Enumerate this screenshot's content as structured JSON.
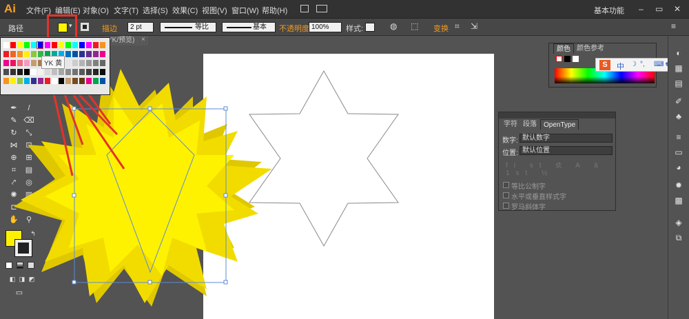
{
  "app": {
    "logo": "Ai",
    "workspace": "基本功能"
  },
  "menus": [
    "文件(F)",
    "编辑(E)",
    "对象(O)",
    "文字(T)",
    "选择(S)",
    "效果(C)",
    "视图(V)",
    "窗口(W)",
    "帮助(H)"
  ],
  "control_bar": {
    "selection_label": "路径",
    "stroke_label": "描边",
    "stroke_weight": "2 pt",
    "profile_label": "等比",
    "brush_label": "基本",
    "opacity_label": "不透明度",
    "opacity_value": "100%",
    "style_label": "样式:",
    "transform_label": "变换",
    "fill_color": "#fff200"
  },
  "document_tab": "YK/预览)",
  "swatch_tooltip": "YK 黄",
  "colors": {
    "fill": "#fff200",
    "highlight": "#e5332a",
    "arrow": "#e5332a"
  },
  "color_panel": {
    "tab_color": "颜色",
    "tab_guide": "颜色参考"
  },
  "ime": {
    "label": "中"
  },
  "char_panel": {
    "tabs": [
      "字符",
      "段落",
      "OpenType"
    ],
    "number_label": "数字:",
    "number_value": "默认数字",
    "position_label": "位置:",
    "position_value": "默认位置",
    "checks": [
      "等比公制字",
      "水平或垂直样式字",
      "罗马斜体字"
    ]
  }
}
